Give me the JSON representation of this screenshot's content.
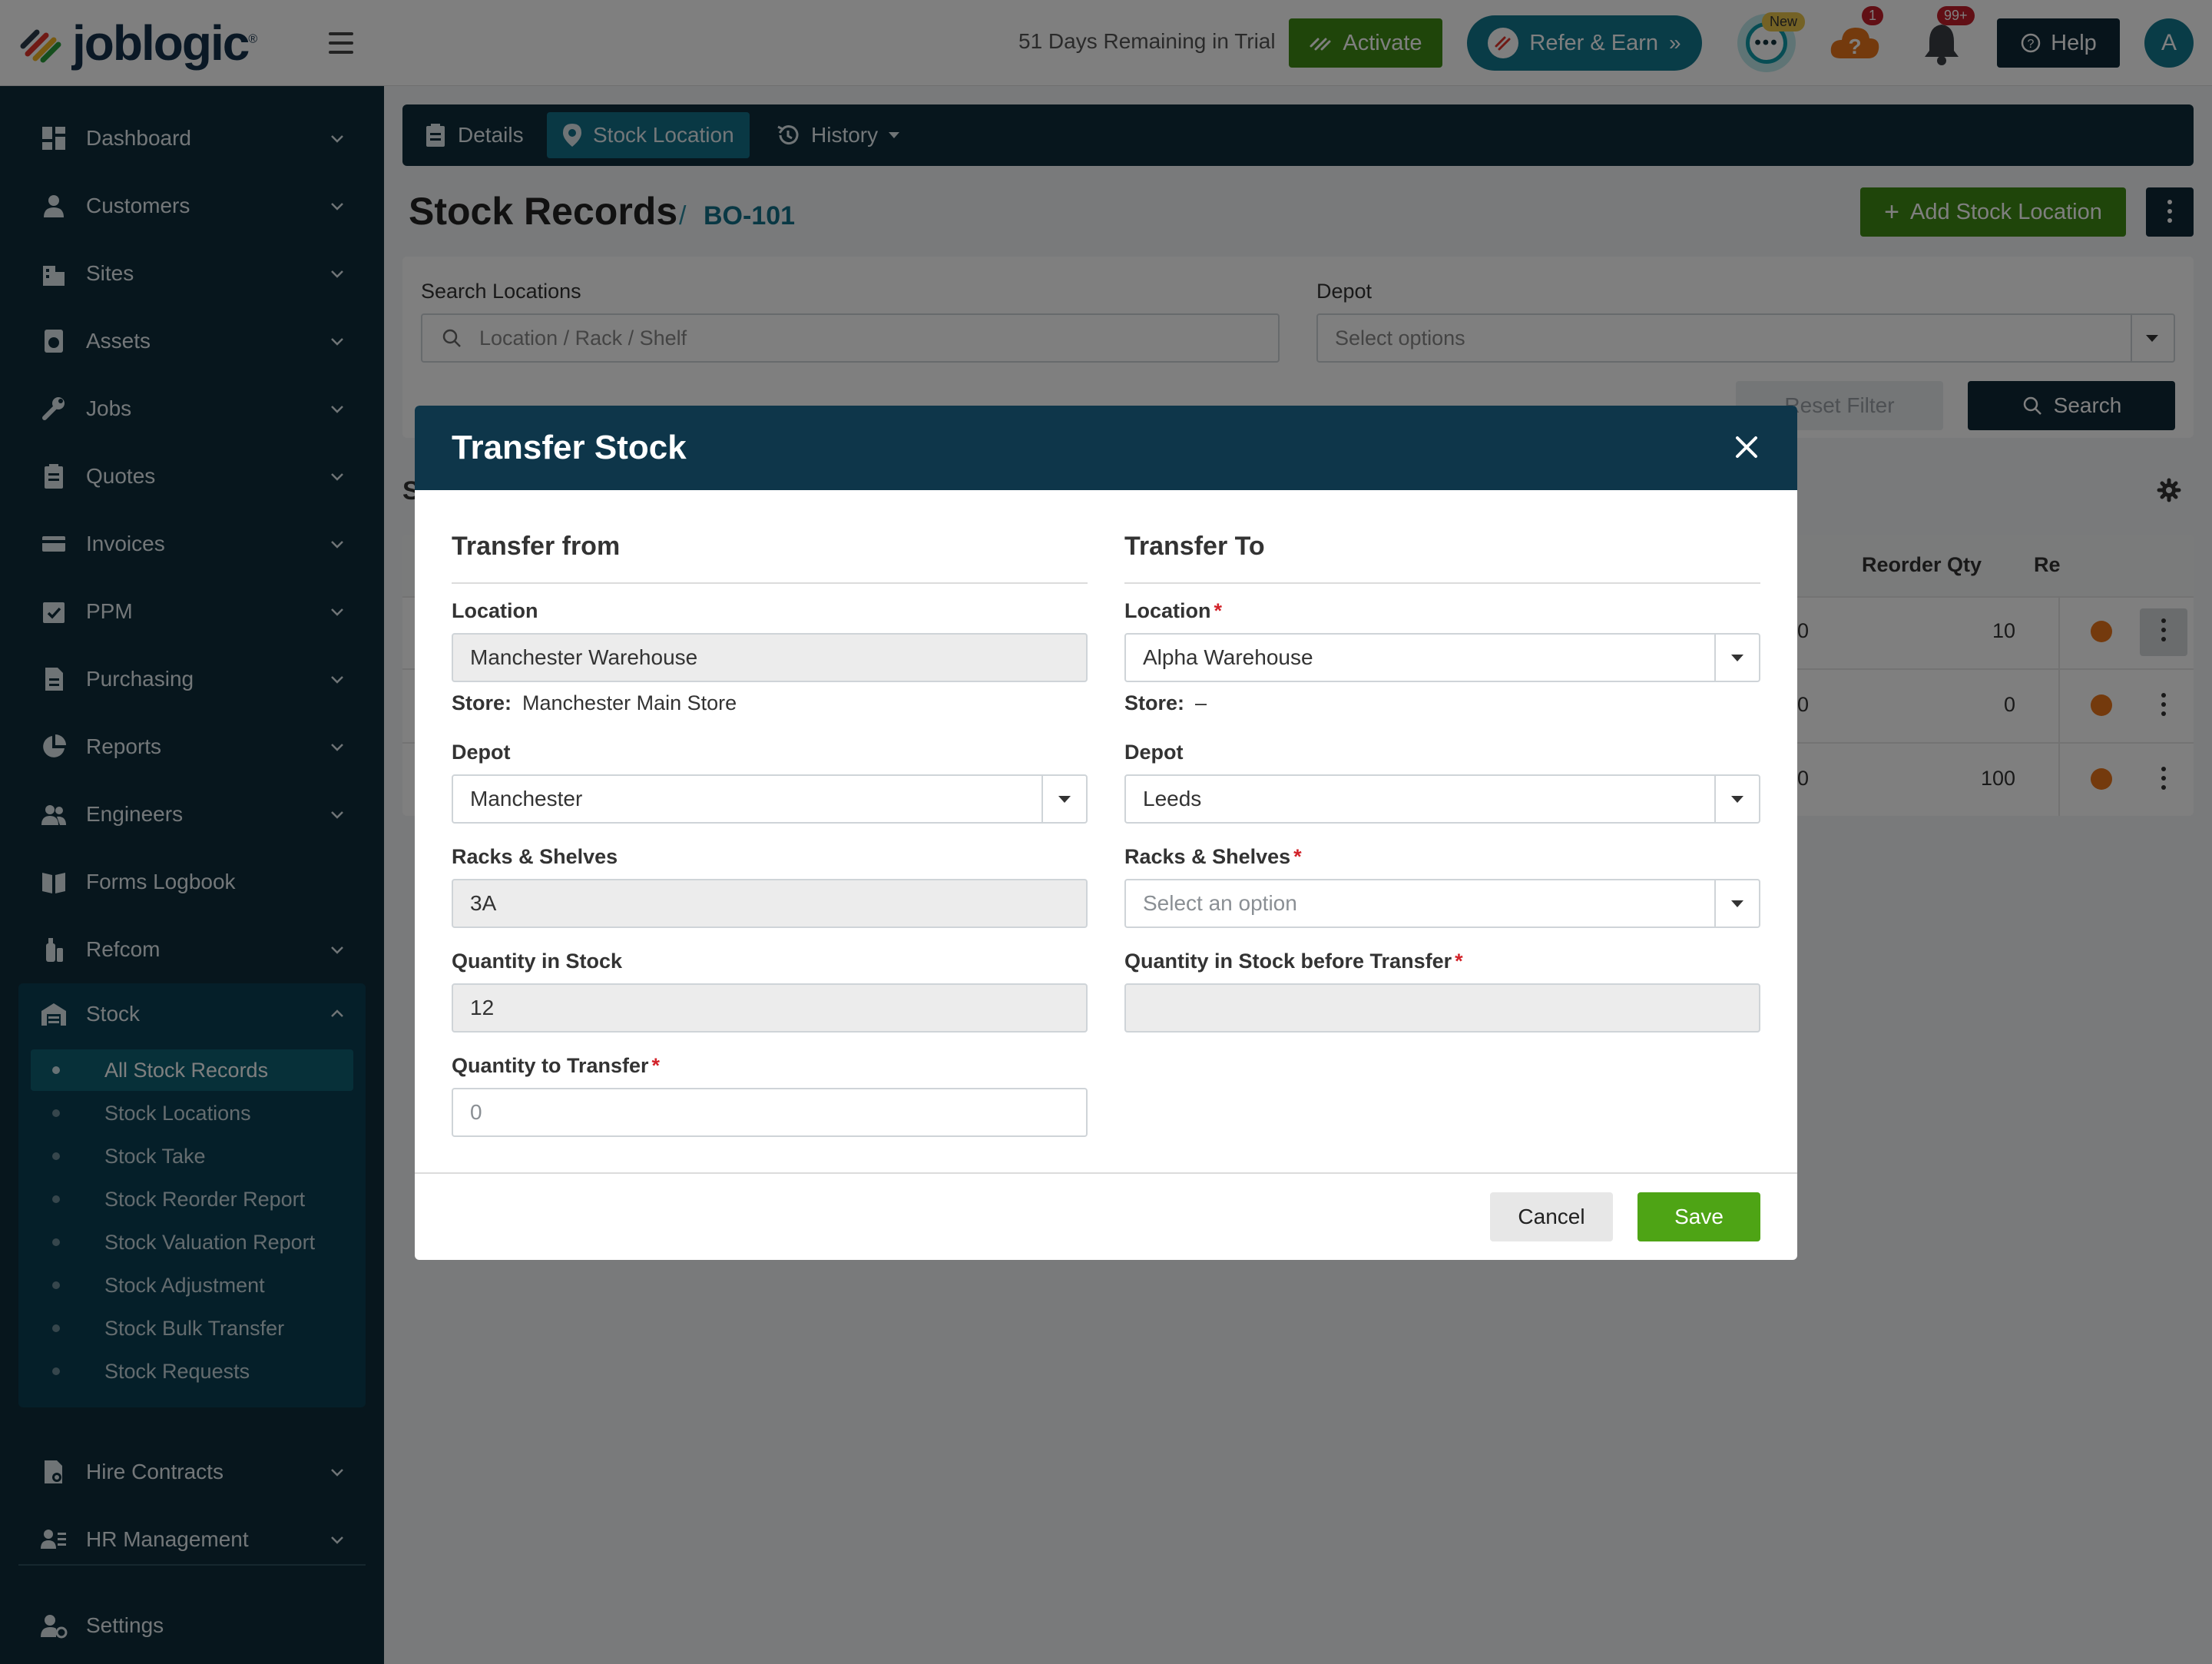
{
  "topbar": {
    "logo_text": "joblogic",
    "logo_mark": "®",
    "trial_text": "51 Days Remaining in Trial",
    "activate_label": "Activate",
    "refer_label": "Refer & Earn",
    "chat_badge": "New",
    "help_badge_count": "1",
    "notifications_badge": "99+",
    "help_label": "Help",
    "avatar_initial": "A",
    "icons": [
      "hamburger-icon",
      "activate-icon",
      "refer-icon",
      "chat-icon",
      "help-cloud-icon",
      "bell-icon",
      "help-circle-icon"
    ]
  },
  "sidebar": {
    "items": [
      {
        "label": "Dashboard",
        "icon": "dashboard-icon",
        "expandable": true
      },
      {
        "label": "Customers",
        "icon": "person-icon",
        "expandable": true
      },
      {
        "label": "Sites",
        "icon": "building-icon",
        "expandable": true
      },
      {
        "label": "Assets",
        "icon": "asset-icon",
        "expandable": true
      },
      {
        "label": "Jobs",
        "icon": "wrench-icon",
        "expandable": true
      },
      {
        "label": "Quotes",
        "icon": "clipboard-icon",
        "expandable": true
      },
      {
        "label": "Invoices",
        "icon": "card-icon",
        "expandable": true
      },
      {
        "label": "PPM",
        "icon": "calendar-check-icon",
        "expandable": true
      },
      {
        "label": "Purchasing",
        "icon": "document-icon",
        "expandable": true
      },
      {
        "label": "Reports",
        "icon": "pie-chart-icon",
        "expandable": true
      },
      {
        "label": "Engineers",
        "icon": "people-icon",
        "expandable": true
      },
      {
        "label": "Forms Logbook",
        "icon": "book-icon",
        "expandable": false
      },
      {
        "label": "Refcom",
        "icon": "cylinder-icon",
        "expandable": true
      },
      {
        "label": "Stock",
        "icon": "warehouse-icon",
        "expandable": true,
        "expanded": true
      },
      {
        "label": "Hire Contracts",
        "icon": "contract-icon",
        "expandable": true
      },
      {
        "label": "HR Management",
        "icon": "hr-icon",
        "expandable": true
      }
    ],
    "stock_subitems": [
      {
        "label": "All Stock Records",
        "active": true
      },
      {
        "label": "Stock Locations"
      },
      {
        "label": "Stock Take"
      },
      {
        "label": "Stock Reorder Report"
      },
      {
        "label": "Stock Valuation Report"
      },
      {
        "label": "Stock Adjustment"
      },
      {
        "label": "Stock Bulk Transfer"
      },
      {
        "label": "Stock Requests"
      }
    ],
    "settings_label": "Settings"
  },
  "tabs": [
    {
      "label": "Details",
      "icon": "clipboard-icon"
    },
    {
      "label": "Stock Location",
      "icon": "map-pin-icon",
      "active": true
    },
    {
      "label": "History",
      "icon": "history-icon"
    }
  ],
  "page": {
    "title": "Stock Records",
    "crumb_separator": "/",
    "record_ref": "BO-101",
    "add_location_label": "Add Stock Location"
  },
  "filters": {
    "search_label": "Search Locations",
    "search_placeholder": "Location / Rack / Shelf",
    "depot_label": "Depot",
    "depot_placeholder": "Select options",
    "reset_label": "Reset Filter",
    "search_button": "Search"
  },
  "table": {
    "section_initial": "S",
    "headers": [
      "Reorder Qty",
      "Re"
    ],
    "rows": [
      {
        "partial": "0",
        "reorder_qty": "10"
      },
      {
        "partial": "0",
        "reorder_qty": "0"
      },
      {
        "partial": "0",
        "reorder_qty": "100"
      }
    ]
  },
  "modal": {
    "title": "Transfer Stock",
    "from": {
      "title": "Transfer from",
      "location_label": "Location",
      "location_value": "Manchester Warehouse",
      "store_label": "Store:",
      "store_value": "Manchester Main Store",
      "depot_label": "Depot",
      "depot_value": "Manchester",
      "racks_label": "Racks & Shelves",
      "racks_value": "3A",
      "qty_stock_label": "Quantity in Stock",
      "qty_stock_value": "12",
      "qty_transfer_label": "Quantity to Transfer",
      "qty_transfer_placeholder": "0"
    },
    "to": {
      "title": "Transfer To",
      "location_label": "Location",
      "location_value": "Alpha Warehouse",
      "store_label": "Store:",
      "store_value": "–",
      "depot_label": "Depot",
      "depot_value": "Leeds",
      "racks_label": "Racks & Shelves",
      "racks_placeholder": "Select an option",
      "qty_before_label": "Quantity in Stock before Transfer",
      "qty_before_value": ""
    },
    "required_mark": "*",
    "cancel_label": "Cancel",
    "save_label": "Save"
  },
  "colors": {
    "sidebar_bg": "#0e2d3b",
    "header_dark": "#0e364a",
    "accent_teal": "#127089",
    "green": "#4ea415",
    "required_red": "#d2232a"
  }
}
